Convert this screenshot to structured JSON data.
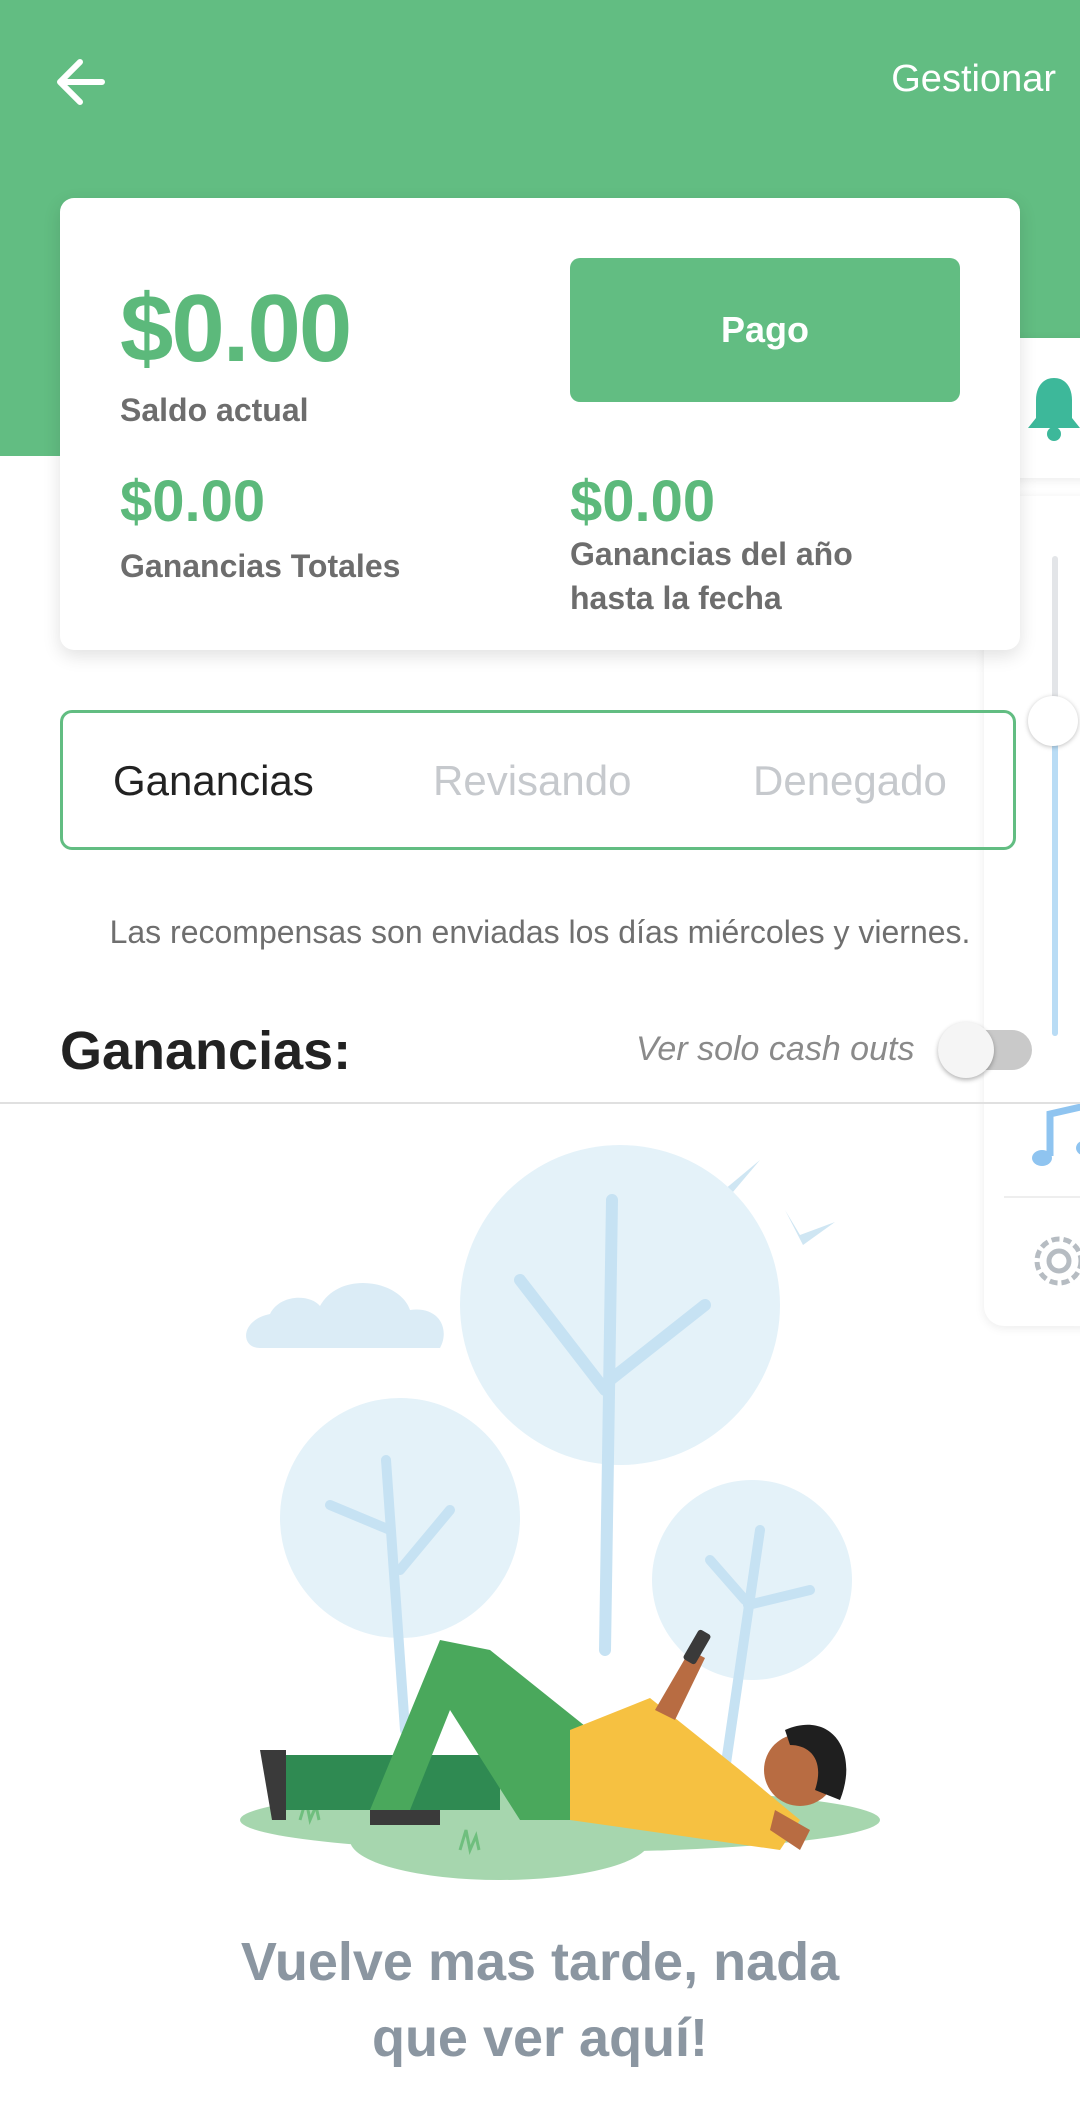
{
  "header": {
    "manage_label": "Gestionar"
  },
  "balance_card": {
    "current_balance": "$0.00",
    "current_balance_label": "Saldo actual",
    "pay_button": "Pago",
    "total_earnings": "$0.00",
    "total_earnings_label": "Ganancias Totales",
    "ytd_earnings": "$0.00",
    "ytd_earnings_label": "Ganancias del año hasta la fecha"
  },
  "tabs": [
    {
      "label": "Ganancias",
      "active": true
    },
    {
      "label": "Revisando",
      "active": false
    },
    {
      "label": "Denegado",
      "active": false
    }
  ],
  "info_text": "Las recompensas son enviadas los días miércoles y viernes.",
  "earnings_section": {
    "title": "Ganancias:",
    "toggle_label": "Ver solo cash outs",
    "toggle_on": false
  },
  "empty_state": {
    "line1": "Vuelve mas tarde, nada",
    "line2": "que ver aquí!"
  },
  "side_panel": {
    "icons": [
      "bell-icon",
      "music-note-icon",
      "gear-icon"
    ]
  },
  "colors": {
    "brand_green": "#62bd82",
    "amount_green": "#5cb97b",
    "muted_text": "#6d6d6d",
    "empty_text": "#8b96a1"
  }
}
